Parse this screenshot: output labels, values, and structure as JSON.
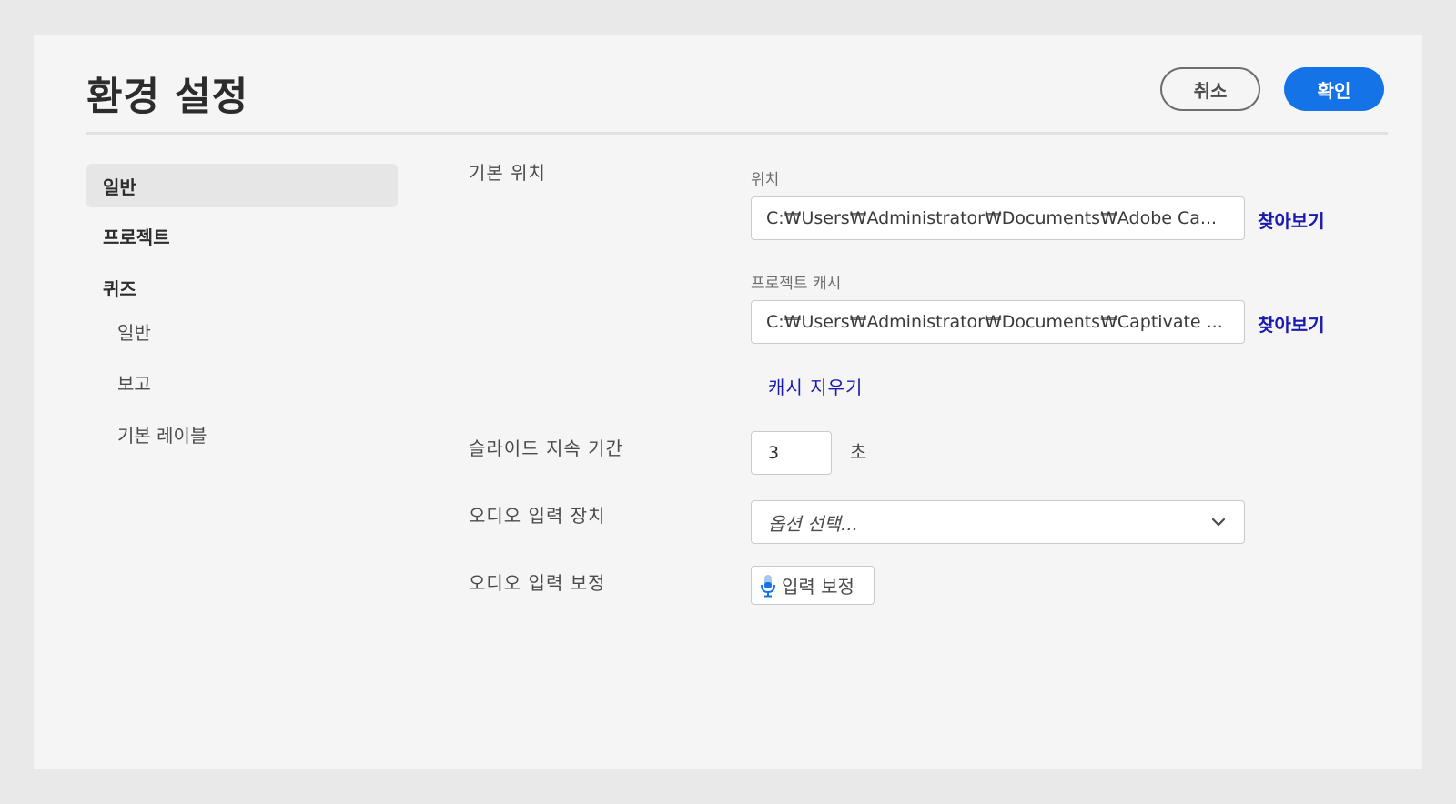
{
  "header": {
    "title": "환경 설정",
    "cancel_label": "취소",
    "ok_label": "확인"
  },
  "sidebar": {
    "items": [
      {
        "label": "일반",
        "selected": true
      },
      {
        "label": "프로젝트"
      },
      {
        "label": "퀴즈"
      }
    ],
    "quiz_sub_items": [
      {
        "label": "일반"
      },
      {
        "label": "보고"
      },
      {
        "label": "기본 레이블"
      }
    ]
  },
  "main": {
    "default_location": {
      "label": "기본 위치",
      "location_caption": "위치",
      "location_value": "C:₩Users₩Administrator₩Documents₩Adobe Ca...",
      "project_cache_caption": "프로젝트 캐시",
      "project_cache_value": "C:₩Users₩Administrator₩Documents₩Captivate ...",
      "browse_label": "찾아보기",
      "clear_cache_label": "캐시 지우기"
    },
    "slide_duration": {
      "label": "슬라이드 지속 기간",
      "value": "3",
      "unit": "초"
    },
    "audio_input_device": {
      "label": "오디오 입력 장치",
      "placeholder": "옵션 선택..."
    },
    "audio_calibration": {
      "label": "오디오 입력 보정",
      "button_label": "입력 보정"
    }
  },
  "colors": {
    "accent": "#1473e6",
    "link": "#1a1ab0",
    "background": "#f5f5f5"
  },
  "icons": {
    "select_chevron": "chevron-down-icon",
    "calibrate": "microphone-icon"
  }
}
